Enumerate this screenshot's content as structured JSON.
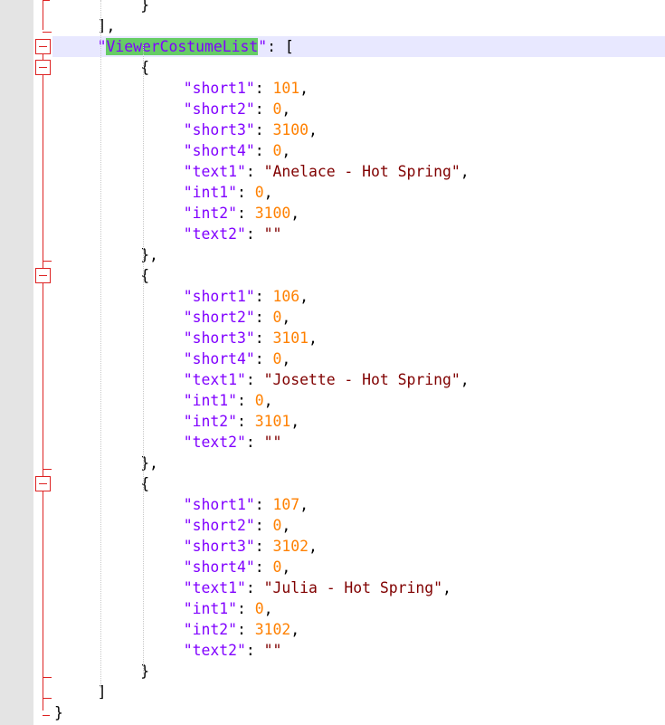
{
  "editor": {
    "colors": {
      "key": "#8000ff",
      "number": "#ff8000",
      "string": "#800000",
      "punctuation": "#000000",
      "current_line": "#e8e8ff",
      "match_highlight": "#66cc66",
      "fold_marker": "#dd2222"
    },
    "lines": [
      {
        "indent": 2,
        "tokens": [
          {
            "t": "op",
            "v": "}"
          }
        ]
      },
      {
        "indent": 1,
        "tokens": [
          {
            "t": "op",
            "v": "],"
          }
        ]
      },
      {
        "indent": 1,
        "highlight": true,
        "tokens": [
          {
            "t": "key",
            "v": "\""
          },
          {
            "t": "key",
            "v": "ViewerCostumeList",
            "hl": true
          },
          {
            "t": "key",
            "v": "\""
          },
          {
            "t": "op",
            "v": ": ["
          }
        ]
      },
      {
        "indent": 2,
        "tokens": [
          {
            "t": "op",
            "v": "{"
          }
        ]
      },
      {
        "indent": 3,
        "tokens": [
          {
            "t": "key",
            "v": "\"short1\""
          },
          {
            "t": "op",
            "v": ": "
          },
          {
            "t": "num",
            "v": "101"
          },
          {
            "t": "op",
            "v": ","
          }
        ]
      },
      {
        "indent": 3,
        "tokens": [
          {
            "t": "key",
            "v": "\"short2\""
          },
          {
            "t": "op",
            "v": ": "
          },
          {
            "t": "num",
            "v": "0"
          },
          {
            "t": "op",
            "v": ","
          }
        ]
      },
      {
        "indent": 3,
        "tokens": [
          {
            "t": "key",
            "v": "\"short3\""
          },
          {
            "t": "op",
            "v": ": "
          },
          {
            "t": "num",
            "v": "3100"
          },
          {
            "t": "op",
            "v": ","
          }
        ]
      },
      {
        "indent": 3,
        "tokens": [
          {
            "t": "key",
            "v": "\"short4\""
          },
          {
            "t": "op",
            "v": ": "
          },
          {
            "t": "num",
            "v": "0"
          },
          {
            "t": "op",
            "v": ","
          }
        ]
      },
      {
        "indent": 3,
        "tokens": [
          {
            "t": "key",
            "v": "\"text1\""
          },
          {
            "t": "op",
            "v": ": "
          },
          {
            "t": "str",
            "v": "\"Anelace - Hot Spring\""
          },
          {
            "t": "op",
            "v": ","
          }
        ]
      },
      {
        "indent": 3,
        "tokens": [
          {
            "t": "key",
            "v": "\"int1\""
          },
          {
            "t": "op",
            "v": ": "
          },
          {
            "t": "num",
            "v": "0"
          },
          {
            "t": "op",
            "v": ","
          }
        ]
      },
      {
        "indent": 3,
        "tokens": [
          {
            "t": "key",
            "v": "\"int2\""
          },
          {
            "t": "op",
            "v": ": "
          },
          {
            "t": "num",
            "v": "3100"
          },
          {
            "t": "op",
            "v": ","
          }
        ]
      },
      {
        "indent": 3,
        "tokens": [
          {
            "t": "key",
            "v": "\"text2\""
          },
          {
            "t": "op",
            "v": ": "
          },
          {
            "t": "str",
            "v": "\"\""
          }
        ]
      },
      {
        "indent": 2,
        "tokens": [
          {
            "t": "op",
            "v": "},"
          }
        ]
      },
      {
        "indent": 2,
        "tokens": [
          {
            "t": "op",
            "v": "{"
          }
        ]
      },
      {
        "indent": 3,
        "tokens": [
          {
            "t": "key",
            "v": "\"short1\""
          },
          {
            "t": "op",
            "v": ": "
          },
          {
            "t": "num",
            "v": "106"
          },
          {
            "t": "op",
            "v": ","
          }
        ]
      },
      {
        "indent": 3,
        "tokens": [
          {
            "t": "key",
            "v": "\"short2\""
          },
          {
            "t": "op",
            "v": ": "
          },
          {
            "t": "num",
            "v": "0"
          },
          {
            "t": "op",
            "v": ","
          }
        ]
      },
      {
        "indent": 3,
        "tokens": [
          {
            "t": "key",
            "v": "\"short3\""
          },
          {
            "t": "op",
            "v": ": "
          },
          {
            "t": "num",
            "v": "3101"
          },
          {
            "t": "op",
            "v": ","
          }
        ]
      },
      {
        "indent": 3,
        "tokens": [
          {
            "t": "key",
            "v": "\"short4\""
          },
          {
            "t": "op",
            "v": ": "
          },
          {
            "t": "num",
            "v": "0"
          },
          {
            "t": "op",
            "v": ","
          }
        ]
      },
      {
        "indent": 3,
        "tokens": [
          {
            "t": "key",
            "v": "\"text1\""
          },
          {
            "t": "op",
            "v": ": "
          },
          {
            "t": "str",
            "v": "\"Josette - Hot Spring\""
          },
          {
            "t": "op",
            "v": ","
          }
        ]
      },
      {
        "indent": 3,
        "tokens": [
          {
            "t": "key",
            "v": "\"int1\""
          },
          {
            "t": "op",
            "v": ": "
          },
          {
            "t": "num",
            "v": "0"
          },
          {
            "t": "op",
            "v": ","
          }
        ]
      },
      {
        "indent": 3,
        "tokens": [
          {
            "t": "key",
            "v": "\"int2\""
          },
          {
            "t": "op",
            "v": ": "
          },
          {
            "t": "num",
            "v": "3101"
          },
          {
            "t": "op",
            "v": ","
          }
        ]
      },
      {
        "indent": 3,
        "tokens": [
          {
            "t": "key",
            "v": "\"text2\""
          },
          {
            "t": "op",
            "v": ": "
          },
          {
            "t": "str",
            "v": "\"\""
          }
        ]
      },
      {
        "indent": 2,
        "tokens": [
          {
            "t": "op",
            "v": "},"
          }
        ]
      },
      {
        "indent": 2,
        "tokens": [
          {
            "t": "op",
            "v": "{"
          }
        ]
      },
      {
        "indent": 3,
        "tokens": [
          {
            "t": "key",
            "v": "\"short1\""
          },
          {
            "t": "op",
            "v": ": "
          },
          {
            "t": "num",
            "v": "107"
          },
          {
            "t": "op",
            "v": ","
          }
        ]
      },
      {
        "indent": 3,
        "tokens": [
          {
            "t": "key",
            "v": "\"short2\""
          },
          {
            "t": "op",
            "v": ": "
          },
          {
            "t": "num",
            "v": "0"
          },
          {
            "t": "op",
            "v": ","
          }
        ]
      },
      {
        "indent": 3,
        "tokens": [
          {
            "t": "key",
            "v": "\"short3\""
          },
          {
            "t": "op",
            "v": ": "
          },
          {
            "t": "num",
            "v": "3102"
          },
          {
            "t": "op",
            "v": ","
          }
        ]
      },
      {
        "indent": 3,
        "tokens": [
          {
            "t": "key",
            "v": "\"short4\""
          },
          {
            "t": "op",
            "v": ": "
          },
          {
            "t": "num",
            "v": "0"
          },
          {
            "t": "op",
            "v": ","
          }
        ]
      },
      {
        "indent": 3,
        "tokens": [
          {
            "t": "key",
            "v": "\"text1\""
          },
          {
            "t": "op",
            "v": ": "
          },
          {
            "t": "str",
            "v": "\"Julia - Hot Spring\""
          },
          {
            "t": "op",
            "v": ","
          }
        ]
      },
      {
        "indent": 3,
        "tokens": [
          {
            "t": "key",
            "v": "\"int1\""
          },
          {
            "t": "op",
            "v": ": "
          },
          {
            "t": "num",
            "v": "0"
          },
          {
            "t": "op",
            "v": ","
          }
        ]
      },
      {
        "indent": 3,
        "tokens": [
          {
            "t": "key",
            "v": "\"int2\""
          },
          {
            "t": "op",
            "v": ": "
          },
          {
            "t": "num",
            "v": "3102"
          },
          {
            "t": "op",
            "v": ","
          }
        ]
      },
      {
        "indent": 3,
        "tokens": [
          {
            "t": "key",
            "v": "\"text2\""
          },
          {
            "t": "op",
            "v": ": "
          },
          {
            "t": "str",
            "v": "\"\""
          }
        ]
      },
      {
        "indent": 2,
        "tokens": [
          {
            "t": "op",
            "v": "}"
          }
        ]
      },
      {
        "indent": 1,
        "tokens": [
          {
            "t": "op",
            "v": "]"
          }
        ]
      },
      {
        "indent": 0,
        "tokens": [
          {
            "t": "op",
            "v": "}"
          }
        ]
      }
    ]
  }
}
